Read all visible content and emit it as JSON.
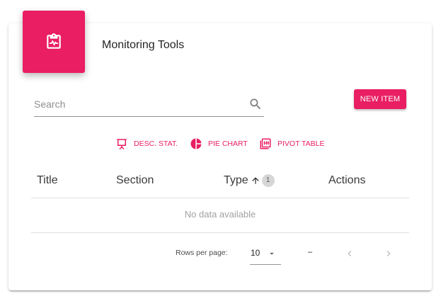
{
  "card": {
    "title": "Monitoring Tools",
    "header_icon": "clipboard-pulse-icon"
  },
  "search": {
    "placeholder": "Search",
    "value": ""
  },
  "toolbar": {
    "new_item_label": "NEW ITEM"
  },
  "tools": [
    {
      "label": "DESC. STAT.",
      "icon": "presentation-board-icon"
    },
    {
      "label": "PIE CHART",
      "icon": "pie-chart-icon"
    },
    {
      "label": "PIVOT TABLE",
      "icon": "pivot-table-icon"
    }
  ],
  "table": {
    "headers": [
      "Title",
      "Section",
      "Type",
      "Actions"
    ],
    "sort_badge": "1",
    "empty_text": "No data available"
  },
  "pagination": {
    "rows_per_page_label": "Rows per page:",
    "rows_per_page_value": "10",
    "range_text": "–"
  },
  "colors": {
    "accent": "#e91e63"
  }
}
